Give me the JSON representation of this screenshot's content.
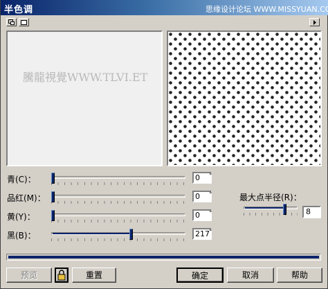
{
  "window": {
    "title": "半色调",
    "watermark_top": "思缘设计论坛 WWW.MISSYUAN.COM"
  },
  "toolbar": {
    "icons": [
      "single-preview-icon",
      "dual-preview-icon",
      "right-arrow-icon"
    ]
  },
  "preview": {
    "watermark": "騰龍視覺WWW.TLVI.ET"
  },
  "sliders": [
    {
      "label": "青(C)：",
      "value": "0",
      "unit": "°",
      "fraction": 0.0
    },
    {
      "label": "品红(M)：",
      "value": "0",
      "unit": "°",
      "fraction": 0.0
    },
    {
      "label": "黄(Y)：",
      "value": "0",
      "unit": "°",
      "fraction": 0.0
    },
    {
      "label": "黑(B)：",
      "value": "217",
      "unit": "°",
      "fraction": 0.6
    }
  ],
  "radius": {
    "label": "最大点半径(R)：",
    "value": "8",
    "fraction": 0.78
  },
  "progress": {
    "fraction": 1.0
  },
  "buttons": {
    "preview": "预览",
    "reset": "重置",
    "ok": "确定",
    "cancel": "取消",
    "help": "帮助"
  },
  "colors": {
    "titlebar_start": "#0a246a",
    "titlebar_end": "#a6caf0",
    "accent": "#0a246a"
  }
}
